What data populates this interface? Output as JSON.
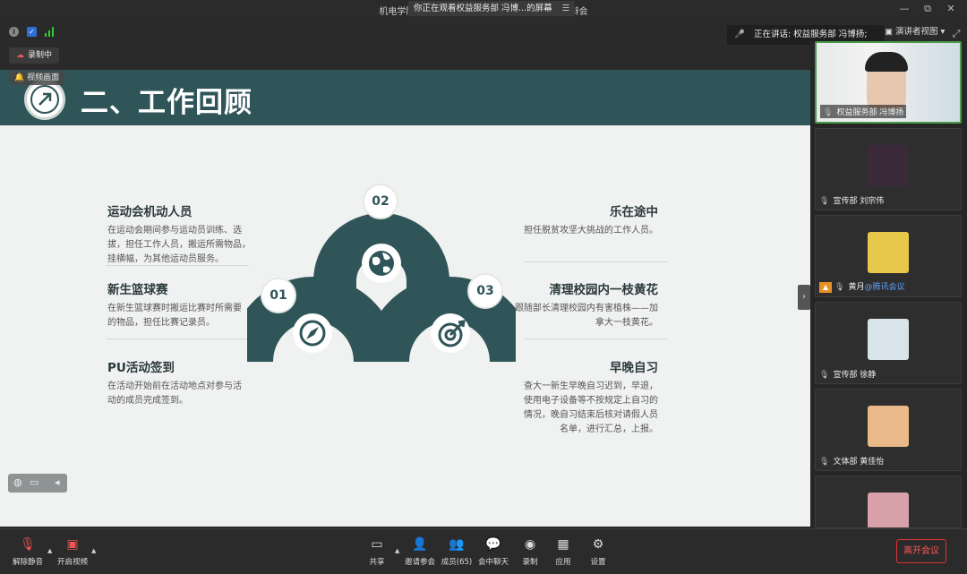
{
  "window": {
    "title_left": "机电学院",
    "title_right": "先答辩会",
    "share_banner": "你正在观看权益服务部 冯博...的屏幕",
    "controls": [
      "—",
      "▢",
      "⧉",
      "✕"
    ]
  },
  "status": {
    "recording": "录制中",
    "subtitle": "视频画面",
    "speaking": "正在讲话: 权益服务部 冯博扬;",
    "view_label": "演讲者视图"
  },
  "slide": {
    "heading": "二、工作回顾",
    "left_items": [
      {
        "title": "运动会机动人员",
        "body": [
          "在运动会期间参与运动员训练、选",
          "拔，担任工作人员，搬运所需物品，",
          "挂横幅，为其他运动员服务。"
        ]
      },
      {
        "title": "新生篮球赛",
        "body": [
          "在新生篮球赛时搬运比赛时所需要",
          "的物品，担任比赛记录员。"
        ]
      },
      {
        "title": "PU活动签到",
        "body": [
          "在活动开始前在活动地点对参与活",
          "动的成员完成签到。"
        ]
      }
    ],
    "right_items": [
      {
        "title": "乐在途中",
        "body": [
          "担任脱贫攻坚大挑战的工作人员。"
        ]
      },
      {
        "title": "清理校园内一枝黄花",
        "body": [
          "跟随部长清理校园内有害植株——加",
          "拿大一枝黄花。"
        ]
      },
      {
        "title": "早晚自习",
        "body": [
          "查大一新生早晚自习迟到，早退，",
          "使用电子设备等不按规定上自习的",
          "情况，晚自习结束后核对请假人员",
          "名单，进行汇总，上报。"
        ]
      }
    ],
    "badges": [
      "01",
      "02",
      "03"
    ]
  },
  "participants": [
    {
      "name": "权益服务部 冯博扬",
      "type": "video"
    },
    {
      "name": "宣传部 刘宗伟",
      "type": "avatar",
      "color": "#3a2a3a"
    },
    {
      "name": "黄月",
      "suffix": "@腾讯会议",
      "type": "avatar",
      "color": "#e8c84a"
    },
    {
      "name": "宣传部 徐静",
      "type": "avatar",
      "color": "#d9e4ea"
    },
    {
      "name": "文体部 黄佳怡",
      "type": "avatar",
      "color": "#e9b98a"
    },
    {
      "name": "",
      "type": "avatar",
      "color": "#d8a0a8"
    }
  ],
  "toolbar": {
    "unmute": "解除静音",
    "start_video": "开启视频",
    "share": "共享",
    "invite": "邀请参会",
    "members": "成员(65)",
    "chat": "会中聊天",
    "record": "录制",
    "apps": "应用",
    "settings": "设置",
    "leave": "离开会议"
  },
  "colors": {
    "slide_header": "#2f5559",
    "accent_dark": "#2f5559",
    "leave_red": "#dd3333"
  }
}
